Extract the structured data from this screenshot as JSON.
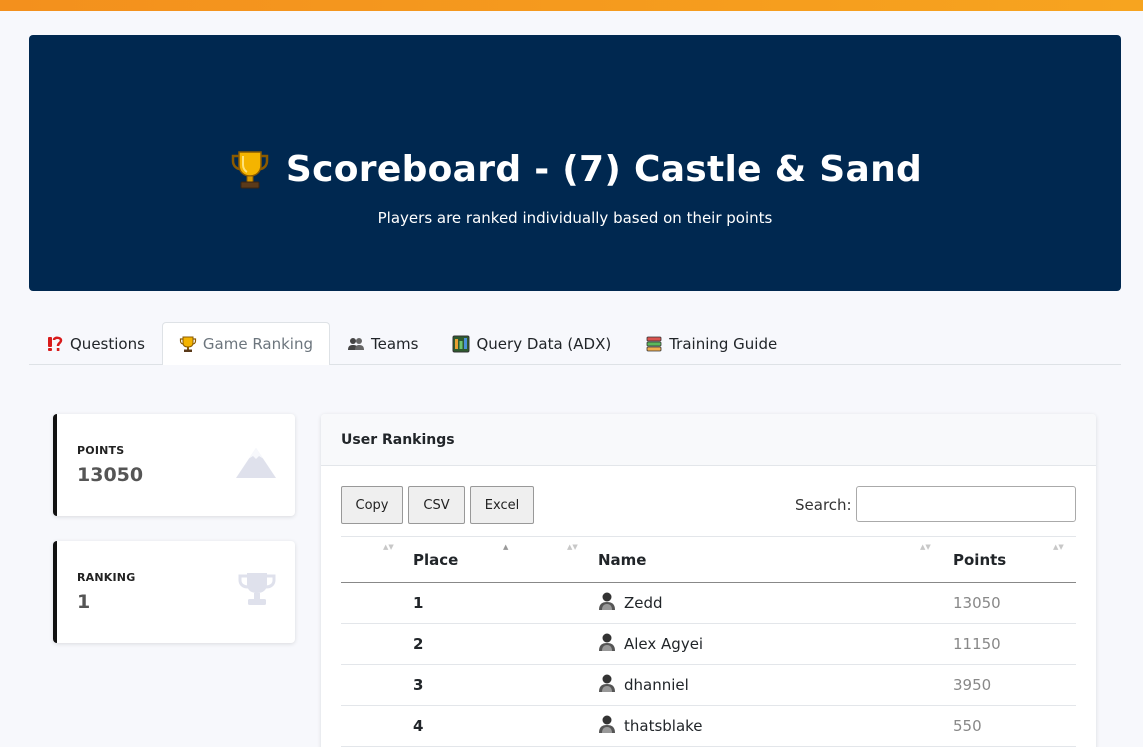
{
  "hero": {
    "title": "Scoreboard - (7) Castle & Sand",
    "subtitle": "Players are ranked individually based on their points"
  },
  "tabs": [
    {
      "label": "Questions",
      "icon": "question-icon",
      "active": false
    },
    {
      "label": "Game Ranking",
      "icon": "trophy-icon",
      "active": true
    },
    {
      "label": "Teams",
      "icon": "users-icon",
      "active": false
    },
    {
      "label": "Query Data (ADX)",
      "icon": "database-icon",
      "active": false
    },
    {
      "label": "Training Guide",
      "icon": "book-icon",
      "active": false
    }
  ],
  "stats": {
    "points": {
      "label": "POINTS",
      "value": "13050",
      "icon": "mountain-icon"
    },
    "ranking": {
      "label": "RANKING",
      "value": "1",
      "icon": "trophy-icon"
    }
  },
  "panel": {
    "title": "User Rankings",
    "buttons": {
      "copy": "Copy",
      "csv": "CSV",
      "excel": "Excel"
    },
    "search_label": "Search:",
    "search_value": "",
    "columns": {
      "place": "Place",
      "name": "Name",
      "points": "Points"
    },
    "rows": [
      {
        "place": "1",
        "name": "Zedd",
        "points": "13050"
      },
      {
        "place": "2",
        "name": "Alex Agyei",
        "points": "11150"
      },
      {
        "place": "3",
        "name": "dhanniel",
        "points": "3950"
      },
      {
        "place": "4",
        "name": "thatsblake",
        "points": "550"
      }
    ]
  },
  "colors": {
    "accent_bar": "#f7a41f",
    "hero_bg": "#002850"
  }
}
